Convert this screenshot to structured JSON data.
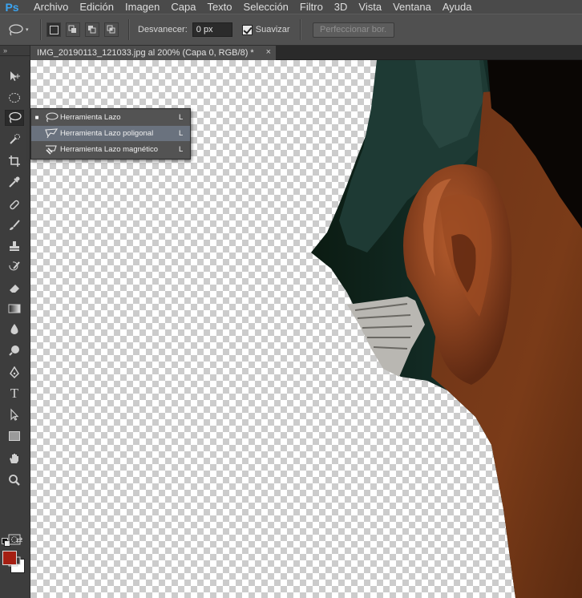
{
  "app": {
    "logo": "Ps"
  },
  "menu": [
    "Archivo",
    "Edición",
    "Imagen",
    "Capa",
    "Texto",
    "Selección",
    "Filtro",
    "3D",
    "Vista",
    "Ventana",
    "Ayuda"
  ],
  "options": {
    "feather_label": "Desvanecer:",
    "feather_value": "0 px",
    "antialias_label": "Suavizar",
    "antialias_checked": true,
    "refine_label": "Perfeccionar bor."
  },
  "document": {
    "tab_title": "IMG_20190113_121033.jpg al 200% (Capa 0, RGB/8) *",
    "close_glyph": "×"
  },
  "toolbar": {
    "grip": "»",
    "tools": [
      "move-tool",
      "marquee-tool",
      "lasso-tool",
      "quick-selection-tool",
      "crop-tool",
      "eyedropper-tool",
      "spot-healing-tool",
      "brush-tool",
      "clone-stamp-tool",
      "history-brush-tool",
      "eraser-tool",
      "gradient-tool",
      "blur-tool",
      "dodge-tool",
      "pen-tool",
      "type-tool",
      "path-selection-tool",
      "rectangle-tool",
      "hand-tool",
      "zoom-tool"
    ],
    "foreground_color": "#a51f13",
    "background_color": "#ffffff"
  },
  "flyout": {
    "items": [
      {
        "label": "Herramienta Lazo",
        "shortcut": "L",
        "selected": true
      },
      {
        "label": "Herramienta Lazo poligonal",
        "shortcut": "L",
        "highlighted": true
      },
      {
        "label": "Herramienta Lazo magnético",
        "shortcut": "L"
      }
    ]
  }
}
